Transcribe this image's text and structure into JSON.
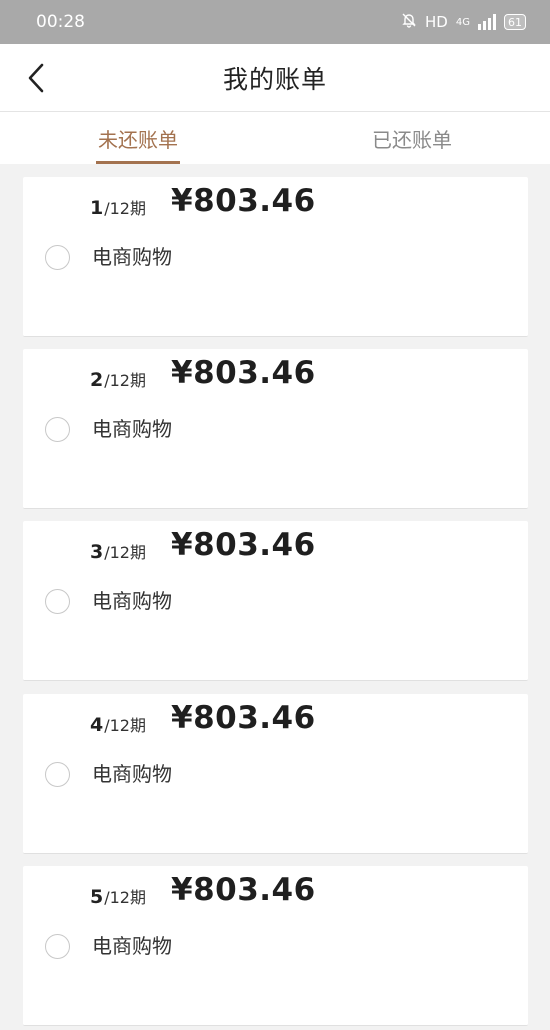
{
  "status_bar": {
    "time": "00:28",
    "network": "HD",
    "signal_type": "4G",
    "battery": "61"
  },
  "nav": {
    "title": "我的账单"
  },
  "tabs": [
    {
      "label": "未还账单",
      "active": true
    },
    {
      "label": "已还账单",
      "active": false
    }
  ],
  "colors": {
    "accent": "#a3724f",
    "status_bar_bg": "#a9a9a9",
    "page_bg": "#f2f2f2"
  },
  "bills": [
    {
      "period": "1",
      "total": "/12期",
      "amount": "¥803.46",
      "category": "电商购物"
    },
    {
      "period": "2",
      "total": "/12期",
      "amount": "¥803.46",
      "category": "电商购物"
    },
    {
      "period": "3",
      "total": "/12期",
      "amount": "¥803.46",
      "category": "电商购物"
    },
    {
      "period": "4",
      "total": "/12期",
      "amount": "¥803.46",
      "category": "电商购物"
    },
    {
      "period": "5",
      "total": "/12期",
      "amount": "¥803.46",
      "category": "电商购物"
    }
  ]
}
